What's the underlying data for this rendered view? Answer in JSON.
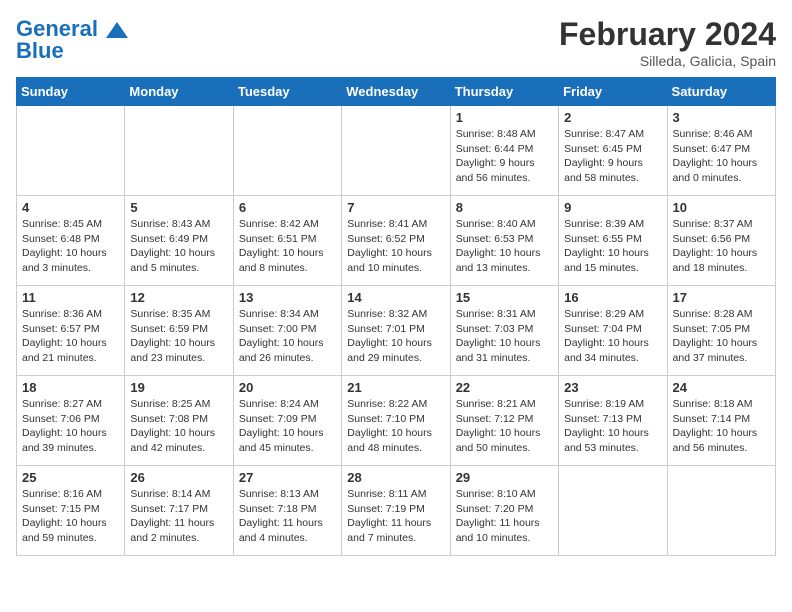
{
  "header": {
    "logo_line1": "General",
    "logo_line2": "Blue",
    "month_title": "February 2024",
    "location": "Silleda, Galicia, Spain"
  },
  "days_of_week": [
    "Sunday",
    "Monday",
    "Tuesday",
    "Wednesday",
    "Thursday",
    "Friday",
    "Saturday"
  ],
  "weeks": [
    [
      {
        "day": "",
        "info": ""
      },
      {
        "day": "",
        "info": ""
      },
      {
        "day": "",
        "info": ""
      },
      {
        "day": "",
        "info": ""
      },
      {
        "day": "1",
        "info": "Sunrise: 8:48 AM\nSunset: 6:44 PM\nDaylight: 9 hours\nand 56 minutes."
      },
      {
        "day": "2",
        "info": "Sunrise: 8:47 AM\nSunset: 6:45 PM\nDaylight: 9 hours\nand 58 minutes."
      },
      {
        "day": "3",
        "info": "Sunrise: 8:46 AM\nSunset: 6:47 PM\nDaylight: 10 hours\nand 0 minutes."
      }
    ],
    [
      {
        "day": "4",
        "info": "Sunrise: 8:45 AM\nSunset: 6:48 PM\nDaylight: 10 hours\nand 3 minutes."
      },
      {
        "day": "5",
        "info": "Sunrise: 8:43 AM\nSunset: 6:49 PM\nDaylight: 10 hours\nand 5 minutes."
      },
      {
        "day": "6",
        "info": "Sunrise: 8:42 AM\nSunset: 6:51 PM\nDaylight: 10 hours\nand 8 minutes."
      },
      {
        "day": "7",
        "info": "Sunrise: 8:41 AM\nSunset: 6:52 PM\nDaylight: 10 hours\nand 10 minutes."
      },
      {
        "day": "8",
        "info": "Sunrise: 8:40 AM\nSunset: 6:53 PM\nDaylight: 10 hours\nand 13 minutes."
      },
      {
        "day": "9",
        "info": "Sunrise: 8:39 AM\nSunset: 6:55 PM\nDaylight: 10 hours\nand 15 minutes."
      },
      {
        "day": "10",
        "info": "Sunrise: 8:37 AM\nSunset: 6:56 PM\nDaylight: 10 hours\nand 18 minutes."
      }
    ],
    [
      {
        "day": "11",
        "info": "Sunrise: 8:36 AM\nSunset: 6:57 PM\nDaylight: 10 hours\nand 21 minutes."
      },
      {
        "day": "12",
        "info": "Sunrise: 8:35 AM\nSunset: 6:59 PM\nDaylight: 10 hours\nand 23 minutes."
      },
      {
        "day": "13",
        "info": "Sunrise: 8:34 AM\nSunset: 7:00 PM\nDaylight: 10 hours\nand 26 minutes."
      },
      {
        "day": "14",
        "info": "Sunrise: 8:32 AM\nSunset: 7:01 PM\nDaylight: 10 hours\nand 29 minutes."
      },
      {
        "day": "15",
        "info": "Sunrise: 8:31 AM\nSunset: 7:03 PM\nDaylight: 10 hours\nand 31 minutes."
      },
      {
        "day": "16",
        "info": "Sunrise: 8:29 AM\nSunset: 7:04 PM\nDaylight: 10 hours\nand 34 minutes."
      },
      {
        "day": "17",
        "info": "Sunrise: 8:28 AM\nSunset: 7:05 PM\nDaylight: 10 hours\nand 37 minutes."
      }
    ],
    [
      {
        "day": "18",
        "info": "Sunrise: 8:27 AM\nSunset: 7:06 PM\nDaylight: 10 hours\nand 39 minutes."
      },
      {
        "day": "19",
        "info": "Sunrise: 8:25 AM\nSunset: 7:08 PM\nDaylight: 10 hours\nand 42 minutes."
      },
      {
        "day": "20",
        "info": "Sunrise: 8:24 AM\nSunset: 7:09 PM\nDaylight: 10 hours\nand 45 minutes."
      },
      {
        "day": "21",
        "info": "Sunrise: 8:22 AM\nSunset: 7:10 PM\nDaylight: 10 hours\nand 48 minutes."
      },
      {
        "day": "22",
        "info": "Sunrise: 8:21 AM\nSunset: 7:12 PM\nDaylight: 10 hours\nand 50 minutes."
      },
      {
        "day": "23",
        "info": "Sunrise: 8:19 AM\nSunset: 7:13 PM\nDaylight: 10 hours\nand 53 minutes."
      },
      {
        "day": "24",
        "info": "Sunrise: 8:18 AM\nSunset: 7:14 PM\nDaylight: 10 hours\nand 56 minutes."
      }
    ],
    [
      {
        "day": "25",
        "info": "Sunrise: 8:16 AM\nSunset: 7:15 PM\nDaylight: 10 hours\nand 59 minutes."
      },
      {
        "day": "26",
        "info": "Sunrise: 8:14 AM\nSunset: 7:17 PM\nDaylight: 11 hours\nand 2 minutes."
      },
      {
        "day": "27",
        "info": "Sunrise: 8:13 AM\nSunset: 7:18 PM\nDaylight: 11 hours\nand 4 minutes."
      },
      {
        "day": "28",
        "info": "Sunrise: 8:11 AM\nSunset: 7:19 PM\nDaylight: 11 hours\nand 7 minutes."
      },
      {
        "day": "29",
        "info": "Sunrise: 8:10 AM\nSunset: 7:20 PM\nDaylight: 11 hours\nand 10 minutes."
      },
      {
        "day": "",
        "info": ""
      },
      {
        "day": "",
        "info": ""
      }
    ]
  ]
}
